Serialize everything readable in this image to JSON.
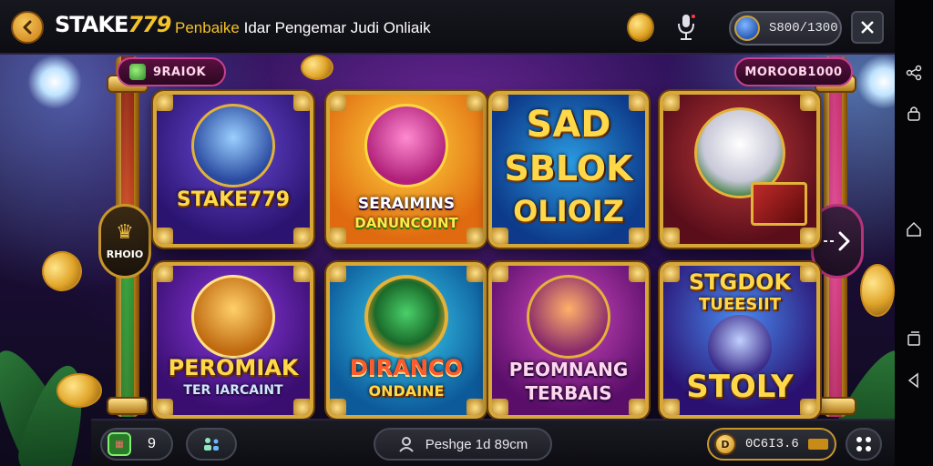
{
  "app": {
    "brand_main": "STAKE",
    "brand_num": "779",
    "tagline_part1": "Penbaike",
    "tagline_part2": " Idar Pengemar Judi Onliaik"
  },
  "topbar": {
    "balance": "S800/1300",
    "icons": [
      "back-arrow-icon",
      "coin-icon",
      "microphone-icon",
      "avatar-icon",
      "close-icon"
    ]
  },
  "banners": {
    "left": "9RAIOK",
    "right": "MOROOB1000"
  },
  "side": {
    "left_badge_label": "RHOIO"
  },
  "games": [
    {
      "title_line1": "STAKE779",
      "title_line2": ""
    },
    {
      "title_line1": "SERAIMINS",
      "title_line2": "DANUNCOINT"
    },
    {
      "title_line1": "SAD",
      "title_line2": "SBLOK",
      "title_line3": "OLIOIZ"
    },
    {
      "title_line1": "",
      "title_line2": ""
    },
    {
      "title_line1": "PEROMIAK",
      "title_line2": "TER IARCAINT"
    },
    {
      "title_line1": "DIRANCO",
      "title_line2": "ONDAINE"
    },
    {
      "title_line1": "PEOMNANG",
      "title_line2": "TERBAIS"
    },
    {
      "title_line1": "STGDOK",
      "title_line2": "TUEESIIT",
      "title_line3": "STOLY"
    }
  ],
  "bottombar": {
    "left_count": "9",
    "search_text": "Peshge 1d 89cm",
    "credit_value": "0C6I3.6"
  },
  "colors": {
    "gold": "#f4c22a",
    "card_border": "#d7a738",
    "magenta": "#c94090"
  }
}
